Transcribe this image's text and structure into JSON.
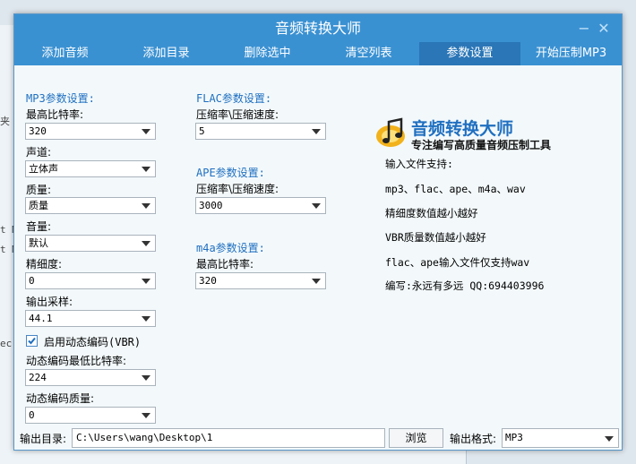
{
  "background": {
    "labels": [
      "夹",
      "t M",
      "t M",
      "ec"
    ]
  },
  "window": {
    "title": "音频转换大师",
    "minimize_glyph": "−",
    "close_glyph": "✕"
  },
  "tabs": [
    {
      "label": "添加音频"
    },
    {
      "label": "添加目录"
    },
    {
      "label": "删除选中"
    },
    {
      "label": "清空列表"
    },
    {
      "label": "参数设置",
      "active": true
    },
    {
      "label": "开始压制MP3"
    }
  ],
  "mp3": {
    "section_title": "MP3参数设置:",
    "max_bitrate_label": "最高比特率:",
    "max_bitrate_value": "320",
    "channel_label": "声道:",
    "channel_value": "立体声",
    "quality_label": "质量:",
    "quality_value": "质量",
    "volume_label": "音量:",
    "volume_value": "默认",
    "precision_label": "精细度:",
    "precision_value": "0",
    "sample_label": "输出采样:",
    "sample_value": "44.1",
    "vbr_checkbox_label": "启用动态编码(VBR)",
    "vbr_checked": true,
    "vbr_min_label": "动态编码最低比特率:",
    "vbr_min_value": "224",
    "vbr_quality_label": "动态编码质量:",
    "vbr_quality_value": "0"
  },
  "flac": {
    "section_title": "FLAC参数设置:",
    "compression_label": "压缩率\\压缩速度:",
    "compression_value": "5"
  },
  "ape": {
    "section_title": "APE参数设置:",
    "compression_label": "压缩率\\压缩速度:",
    "compression_value": "3000"
  },
  "m4a": {
    "section_title": "m4a参数设置:",
    "max_bitrate_label": "最高比特率:",
    "max_bitrate_value": "320"
  },
  "brand": {
    "title": "音频转换大师",
    "subtitle": "专注编写高质量音频压制工具"
  },
  "info": {
    "supported_label": "输入文件支持:",
    "supported_formats": "mp3、flac、ape、m4a、wav",
    "note_precision": "精细度数值越小越好",
    "note_vbr": "VBR质量数值越小越好",
    "note_wav": "flac、ape输入文件仅支持wav",
    "author": "编写:永远有多远 QQ:694403996"
  },
  "bottom": {
    "output_dir_label": "输出目录:",
    "output_dir_value": "C:\\Users\\wang\\Desktop\\1",
    "browse_label": "浏览",
    "format_label": "输出格式:",
    "format_value": "MP3"
  },
  "colors": {
    "titlebar": "#3a91d2",
    "tab_active": "#2a76b7",
    "section_title": "#1f6fc0",
    "window_bg": "#f3f9fb"
  }
}
